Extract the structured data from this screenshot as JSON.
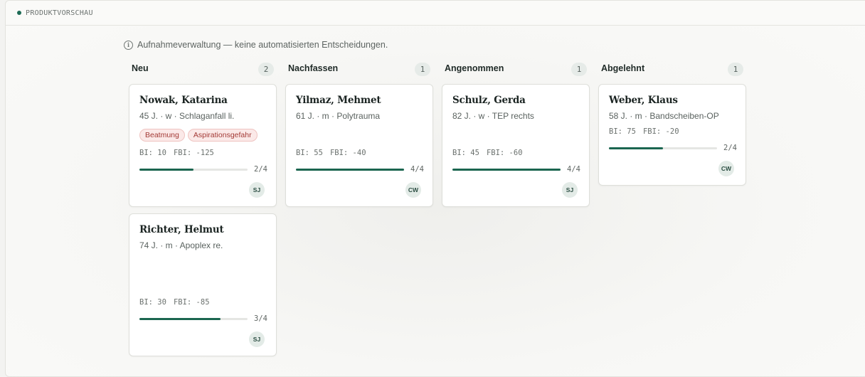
{
  "header": {
    "label": "PRODUKTVORSCHAU"
  },
  "notice": {
    "text": "Aufnahmeverwaltung — keine automatisierten Entscheidungen."
  },
  "columns": [
    {
      "title": "Neu",
      "count": "2",
      "cards": [
        {
          "name": "Nowak, Katarina",
          "meta": "45 J. · w · Schlaganfall li.",
          "tags": [
            "Beatmung",
            "Aspirationsgefahr"
          ],
          "bi": "BI: 10",
          "fbi": "FBI: -125",
          "progress_text": "2/4",
          "progress": 0.5,
          "avatar": "SJ"
        },
        {
          "name": "Richter, Helmut",
          "meta": "74 J. · m · Apoplex re.",
          "tags": [],
          "bi": "BI: 30",
          "fbi": "FBI: -85",
          "progress_text": "3/4",
          "progress": 0.75,
          "avatar": "SJ"
        }
      ]
    },
    {
      "title": "Nachfassen",
      "count": "1",
      "cards": [
        {
          "name": "Yilmaz, Mehmet",
          "meta": "61 J. · m · Polytrauma",
          "tags": [],
          "bi": "BI: 55",
          "fbi": "FBI: -40",
          "progress_text": "4/4",
          "progress": 1.0,
          "avatar": "CW"
        }
      ]
    },
    {
      "title": "Angenommen",
      "count": "1",
      "cards": [
        {
          "name": "Schulz, Gerda",
          "meta": "82 J. · w · TEP rechts",
          "tags": [],
          "bi": "BI: 45",
          "fbi": "FBI: -60",
          "progress_text": "4/4",
          "progress": 1.0,
          "avatar": "SJ"
        }
      ]
    },
    {
      "title": "Abgelehnt",
      "count": "1",
      "cards": [
        {
          "name": "Weber, Klaus",
          "meta": "58 J. · m · Bandscheiben-OP",
          "tags": [],
          "bi": "BI: 75",
          "fbi": "FBI: -20",
          "progress_text": "2/4",
          "progress": 0.5,
          "avatar": "CW"
        }
      ]
    }
  ]
}
